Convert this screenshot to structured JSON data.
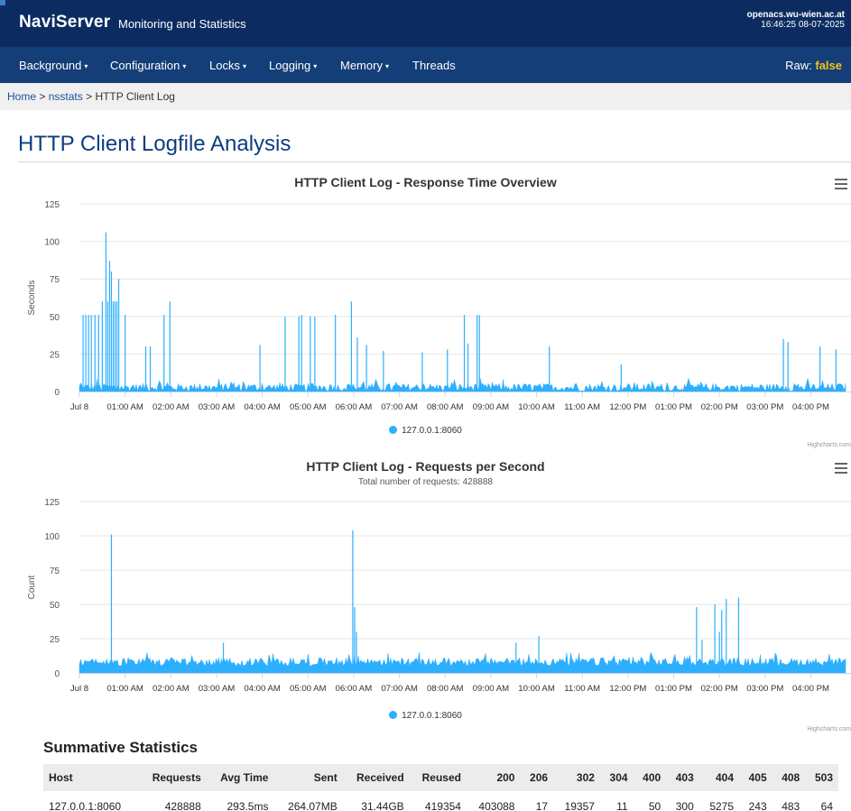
{
  "header": {
    "brand": "NaviServer",
    "subtitle": "Monitoring and Statistics",
    "hostname": "openacs.wu-wien.ac.at",
    "datetime": "16:46:25 08-07-2025"
  },
  "nav": {
    "items": [
      {
        "label": "Background",
        "dropdown": true
      },
      {
        "label": "Configuration",
        "dropdown": true
      },
      {
        "label": "Locks",
        "dropdown": true
      },
      {
        "label": "Logging",
        "dropdown": true
      },
      {
        "label": "Memory",
        "dropdown": true
      },
      {
        "label": "Threads",
        "dropdown": false
      }
    ],
    "raw_label": "Raw:",
    "raw_value": "false",
    "caret": "▾"
  },
  "breadcrumb": {
    "home": "Home",
    "sep": ">",
    "nsstats": "nsstats",
    "current": "HTTP Client Log"
  },
  "page_title": "HTTP Client Logfile Analysis",
  "colors": {
    "series": "#2caffe",
    "header_bg": "#0c2c61",
    "nav_bg": "#143e78",
    "raw_value": "#f5c518",
    "title": "#0d3d80"
  },
  "icons": {
    "chart_menu": "hamburger-menu-icon",
    "legend_marker": "circle"
  },
  "chart_data": [
    {
      "type": "area",
      "title": "HTTP Client Log - Response Time Overview",
      "subtitle": "",
      "ylabel": "Seconds",
      "xlabel": "",
      "ylim": [
        0,
        125
      ],
      "yticks": [
        0,
        25,
        50,
        75,
        100,
        125
      ],
      "xlim_hours": [
        0,
        16.76
      ],
      "xticks": [
        "Jul 8",
        "01:00 AM",
        "02:00 AM",
        "03:00 AM",
        "04:00 AM",
        "05:00 AM",
        "06:00 AM",
        "07:00 AM",
        "08:00 AM",
        "09:00 AM",
        "10:00 AM",
        "11:00 AM",
        "12:00 PM",
        "01:00 PM",
        "02:00 PM",
        "03:00 PM",
        "04:00 PM"
      ],
      "grid": true,
      "legend": "bottom-center",
      "series": [
        {
          "name": "127.0.0.1:8060",
          "baseline_range": [
            0,
            9
          ],
          "spikes": [
            {
              "t": 0.08,
              "v": 51
            },
            {
              "t": 0.14,
              "v": 51
            },
            {
              "t": 0.2,
              "v": 51
            },
            {
              "t": 0.26,
              "v": 51
            },
            {
              "t": 0.34,
              "v": 51
            },
            {
              "t": 0.42,
              "v": 51
            },
            {
              "t": 0.5,
              "v": 60
            },
            {
              "t": 0.58,
              "v": 106
            },
            {
              "t": 0.62,
              "v": 60
            },
            {
              "t": 0.66,
              "v": 87
            },
            {
              "t": 0.7,
              "v": 80
            },
            {
              "t": 0.74,
              "v": 60
            },
            {
              "t": 0.78,
              "v": 60
            },
            {
              "t": 0.82,
              "v": 60
            },
            {
              "t": 0.86,
              "v": 75
            },
            {
              "t": 1.0,
              "v": 51
            },
            {
              "t": 1.45,
              "v": 30
            },
            {
              "t": 1.55,
              "v": 30
            },
            {
              "t": 1.85,
              "v": 51
            },
            {
              "t": 1.98,
              "v": 60
            },
            {
              "t": 3.95,
              "v": 31
            },
            {
              "t": 4.5,
              "v": 50
            },
            {
              "t": 4.8,
              "v": 50
            },
            {
              "t": 4.86,
              "v": 51
            },
            {
              "t": 5.05,
              "v": 50
            },
            {
              "t": 5.15,
              "v": 50
            },
            {
              "t": 5.6,
              "v": 51
            },
            {
              "t": 5.95,
              "v": 60
            },
            {
              "t": 6.08,
              "v": 36
            },
            {
              "t": 6.28,
              "v": 31
            },
            {
              "t": 6.65,
              "v": 27
            },
            {
              "t": 7.5,
              "v": 26
            },
            {
              "t": 8.05,
              "v": 28
            },
            {
              "t": 8.42,
              "v": 51
            },
            {
              "t": 8.5,
              "v": 32
            },
            {
              "t": 8.7,
              "v": 51
            },
            {
              "t": 8.75,
              "v": 51
            },
            {
              "t": 10.28,
              "v": 30
            },
            {
              "t": 11.85,
              "v": 18
            },
            {
              "t": 15.4,
              "v": 35
            },
            {
              "t": 15.5,
              "v": 33
            },
            {
              "t": 16.2,
              "v": 30
            },
            {
              "t": 16.55,
              "v": 28
            }
          ]
        }
      ],
      "credits": "Highcharts.com"
    },
    {
      "type": "area",
      "title": "HTTP Client Log - Requests per Second",
      "subtitle": "Total number of requests: 428888",
      "ylabel": "Count",
      "xlabel": "",
      "ylim": [
        0,
        125
      ],
      "yticks": [
        0,
        25,
        50,
        75,
        100,
        125
      ],
      "xlim_hours": [
        0,
        16.76
      ],
      "xticks": [
        "Jul 8",
        "01:00 AM",
        "02:00 AM",
        "03:00 AM",
        "04:00 AM",
        "05:00 AM",
        "06:00 AM",
        "07:00 AM",
        "08:00 AM",
        "09:00 AM",
        "10:00 AM",
        "11:00 AM",
        "12:00 PM",
        "01:00 PM",
        "02:00 PM",
        "03:00 PM",
        "04:00 PM"
      ],
      "grid": true,
      "legend": "bottom-center",
      "series": [
        {
          "name": "127.0.0.1:8060",
          "baseline_range": [
            5,
            15
          ],
          "spikes": [
            {
              "t": 0.7,
              "v": 101
            },
            {
              "t": 3.15,
              "v": 22
            },
            {
              "t": 5.98,
              "v": 104
            },
            {
              "t": 6.02,
              "v": 48
            },
            {
              "t": 6.06,
              "v": 30
            },
            {
              "t": 9.55,
              "v": 22
            },
            {
              "t": 10.05,
              "v": 27
            },
            {
              "t": 13.5,
              "v": 48
            },
            {
              "t": 13.62,
              "v": 24
            },
            {
              "t": 13.9,
              "v": 50
            },
            {
              "t": 14.0,
              "v": 30
            },
            {
              "t": 14.05,
              "v": 46
            },
            {
              "t": 14.15,
              "v": 54
            },
            {
              "t": 14.42,
              "v": 55
            }
          ]
        }
      ],
      "credits": "Highcharts.com"
    }
  ],
  "summary": {
    "title": "Summative Statistics",
    "columns": [
      "Host",
      "Requests",
      "Avg Time",
      "Sent",
      "Received",
      "Reused",
      "200",
      "206",
      "302",
      "304",
      "400",
      "403",
      "404",
      "405",
      "408",
      "503"
    ],
    "rows": [
      [
        "127.0.0.1:8060",
        "428888",
        "293.5ms",
        "264.07MB",
        "31.44GB",
        "419354",
        "403088",
        "17",
        "19357",
        "11",
        "50",
        "300",
        "5275",
        "243",
        "483",
        "64"
      ]
    ]
  }
}
